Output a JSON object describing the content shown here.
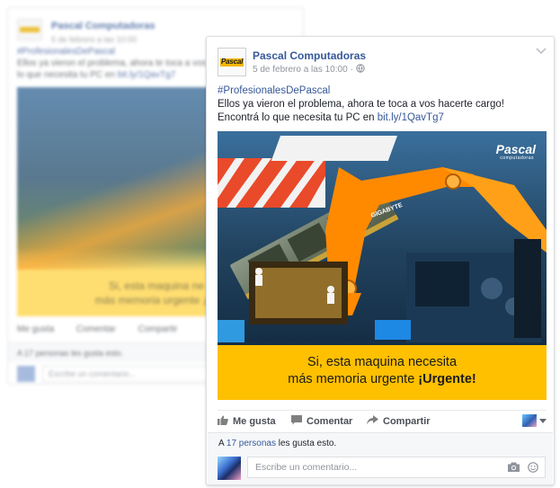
{
  "background_post": {
    "page_name": "Pascal Computadoras",
    "date": "5 de febrero a las 10:00",
    "text_line1": "Ellos ya vieron el problema, ahora te toca a vos h",
    "text_line2": "lo que necesita tu PC en ",
    "link": "bit.ly/1QavTg7",
    "hashtag": "#ProfesionalesDePascal",
    "caption_line1": "Si, esta maquina ne",
    "caption_line2": "más memoria urgente ¡Ur",
    "like": "Me gusta",
    "comment": "Comentar",
    "share": "Compartir",
    "likes_text": "A 17 personas les gusta esto.",
    "comment_placeholder": "Escribe un comentario..."
  },
  "post": {
    "page_name": "Pascal Computadoras",
    "date": "5 de febrero a las 10:00",
    "hashtag": "#ProfesionalesDePascal",
    "text": "Ellos ya vieron el problema, ahora te toca a vos hacerte cargo! Encontrá lo que necesita tu PC en ",
    "link": "bit.ly/1QavTg7",
    "logo_text": "Pascal",
    "image": {
      "brand": "Pascal",
      "brand_sub": "computadoras",
      "chip_label": "GIGABYTE",
      "caption_line1": "Si, esta maquina necesita",
      "caption_line2_regular": "más memoria urgente ",
      "caption_line2_bold": "¡Urgente!",
      "caption_color": "#ffc000"
    }
  },
  "actions": {
    "like": "Me gusta",
    "comment": "Comentar",
    "share": "Compartir"
  },
  "likes": {
    "prefix": "A ",
    "count_link": "17 personas",
    "suffix": " les gusta esto."
  },
  "comment_box": {
    "placeholder": "Escribe un comentario..."
  },
  "colors": {
    "link": "#365899",
    "meta": "#90949c",
    "accent_yellow": "#ffc000"
  }
}
